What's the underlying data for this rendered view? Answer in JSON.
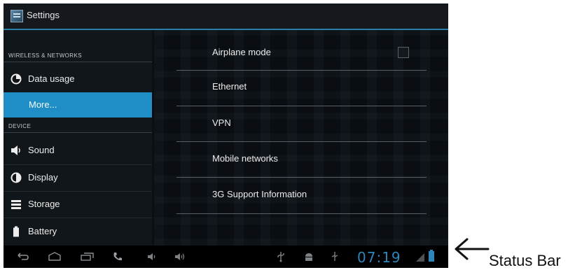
{
  "window": {
    "title": "Settings",
    "app_icon": "settings-app-icon"
  },
  "sidebar": {
    "sections": [
      {
        "header": "WIRELESS & NETWORKS"
      },
      {
        "header": "DEVICE"
      }
    ],
    "items": [
      {
        "label": "Data usage",
        "icon": "data-usage-icon"
      },
      {
        "label": "More...",
        "icon": "",
        "selected": true
      },
      {
        "label": "Sound",
        "icon": "speaker-icon"
      },
      {
        "label": "Display",
        "icon": "display-icon"
      },
      {
        "label": "Storage",
        "icon": "storage-icon"
      },
      {
        "label": "Battery",
        "icon": "battery-icon"
      }
    ]
  },
  "main": {
    "rows": [
      {
        "label": "Airplane mode",
        "has_checkbox": true,
        "checked": false
      },
      {
        "label": "Ethernet"
      },
      {
        "label": "VPN"
      },
      {
        "label": "Mobile networks"
      },
      {
        "label": "3G Support Information"
      }
    ]
  },
  "statusbar": {
    "clock": "07:19",
    "nav_icons": [
      "back-icon",
      "home-icon",
      "recent-apps-icon",
      "phone-icon",
      "volume-down-icon",
      "volume-up-icon"
    ],
    "status_icons": [
      "usb-icon",
      "android-debug-icon",
      "usb-connected-icon",
      "signal-icon",
      "battery-status-icon"
    ]
  },
  "annotation": {
    "label": "Status Bar"
  },
  "colors": {
    "accent": "#1f8ec6",
    "clock": "#2e86b8",
    "background": "#0b0f14"
  }
}
